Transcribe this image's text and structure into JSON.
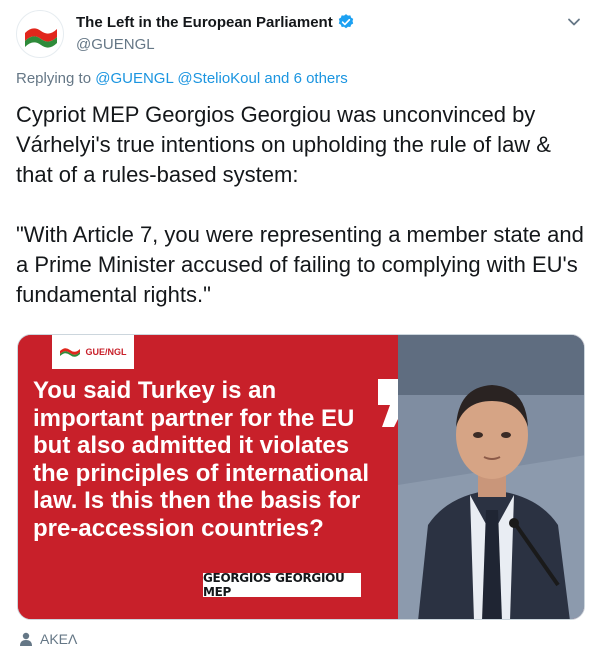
{
  "tweet": {
    "display_name": "The Left in the European Parliament",
    "handle": "@GUENGL",
    "reply_prefix": "Replying to",
    "reply_user_1": "@GUENGL",
    "reply_user_2": "@StelioKoul",
    "reply_others": "and 6 others",
    "text": "Cypriot MEP Georgios Georgiou was unconvinced by Várhelyi's true intentions on upholding the rule of law & that of a rules-based system:\n\n\"With Article 7, you were representing a member state and a Prime Minister accused of failing to complying with EU's fundamental rights.\"",
    "media": {
      "brand_label": "GUE/NGL",
      "quote": "You said Turkey is an important partner for the EU but also admitted it violates the principles of international law. Is this then the basis for pre-accession countries?",
      "speaker": "GEORGIOS GEORGIOU MEP"
    },
    "footer_tag": "AKEΛ"
  },
  "colors": {
    "verified": "#1da1f2",
    "link": "#1b95e0",
    "media_red": "#c8202a",
    "logo_red": "#e1261c",
    "logo_green": "#2e8b3a"
  },
  "icons": {
    "verified": "verified-badge-icon",
    "caret": "chevron-down-icon",
    "footer": "person-icon"
  }
}
